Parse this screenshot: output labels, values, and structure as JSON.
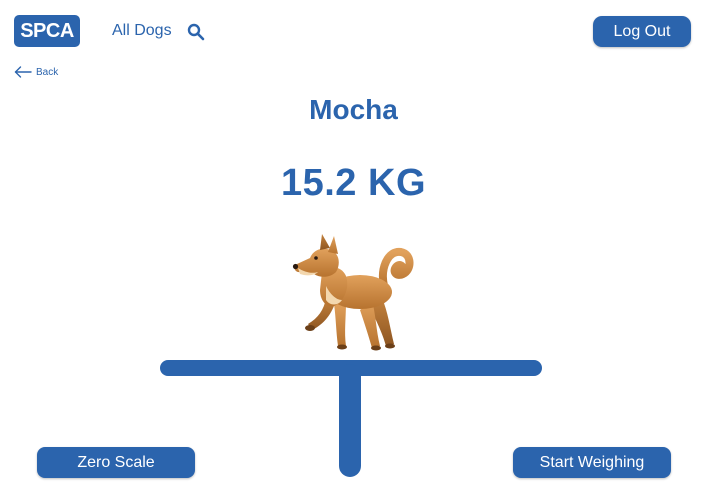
{
  "header": {
    "logo_text": "SPCA",
    "nav_all_dogs": "All Dogs",
    "search_icon": "search-icon",
    "logout_label": "Log Out"
  },
  "back": {
    "label": "Back",
    "icon": "arrow-left-icon"
  },
  "dog": {
    "name": "Mocha",
    "weight": "15.2 KG",
    "image_icon": "dog-icon"
  },
  "actions": {
    "zero_scale_label": "Zero Scale",
    "start_weighing_label": "Start Weighing"
  },
  "colors": {
    "primary": "#2b64ad",
    "button_text": "#ffffff",
    "background": "#ffffff"
  }
}
